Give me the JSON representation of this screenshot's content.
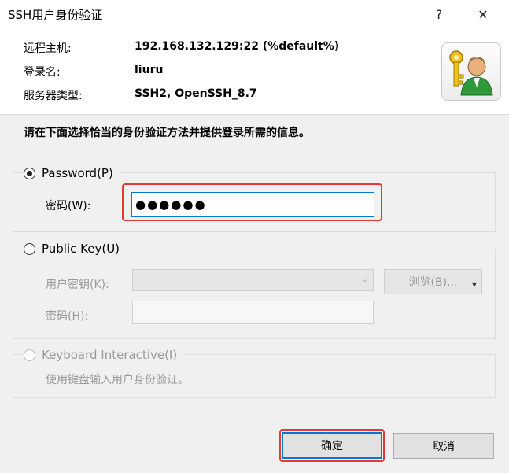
{
  "window": {
    "title": "SSH用户身份验证",
    "help_glyph": "?",
    "close_glyph": "✕"
  },
  "info": {
    "host_label": "远程主机:",
    "host_value": "192.168.132.129:22 (%default%)",
    "login_label": "登录名:",
    "login_value": "liuru",
    "server_type_label": "服务器类型:",
    "server_type_value": "SSH2, OpenSSH_8.7"
  },
  "instruction": "请在下面选择恰当的身份验证方法并提供登录所需的信息。",
  "password_group": {
    "radio_label": "Password(P)",
    "selected": true,
    "field_label": "密码(W):",
    "field_value": "●●●●●●"
  },
  "publickey_group": {
    "radio_label": "Public Key(U)",
    "selected": false,
    "user_key_label": "用户密钥(K):",
    "browse_label": "浏览(B)...",
    "passphrase_label": "密码(H):"
  },
  "keyboard_group": {
    "radio_label": "Keyboard Interactive(I)",
    "selected": false,
    "description": "使用键盘输入用户身份验证。"
  },
  "buttons": {
    "ok_label": "确定",
    "cancel_label": "取消"
  },
  "colors": {
    "highlight": "#e53935",
    "focus": "#0078d7",
    "panel": "#f0f0f0"
  }
}
